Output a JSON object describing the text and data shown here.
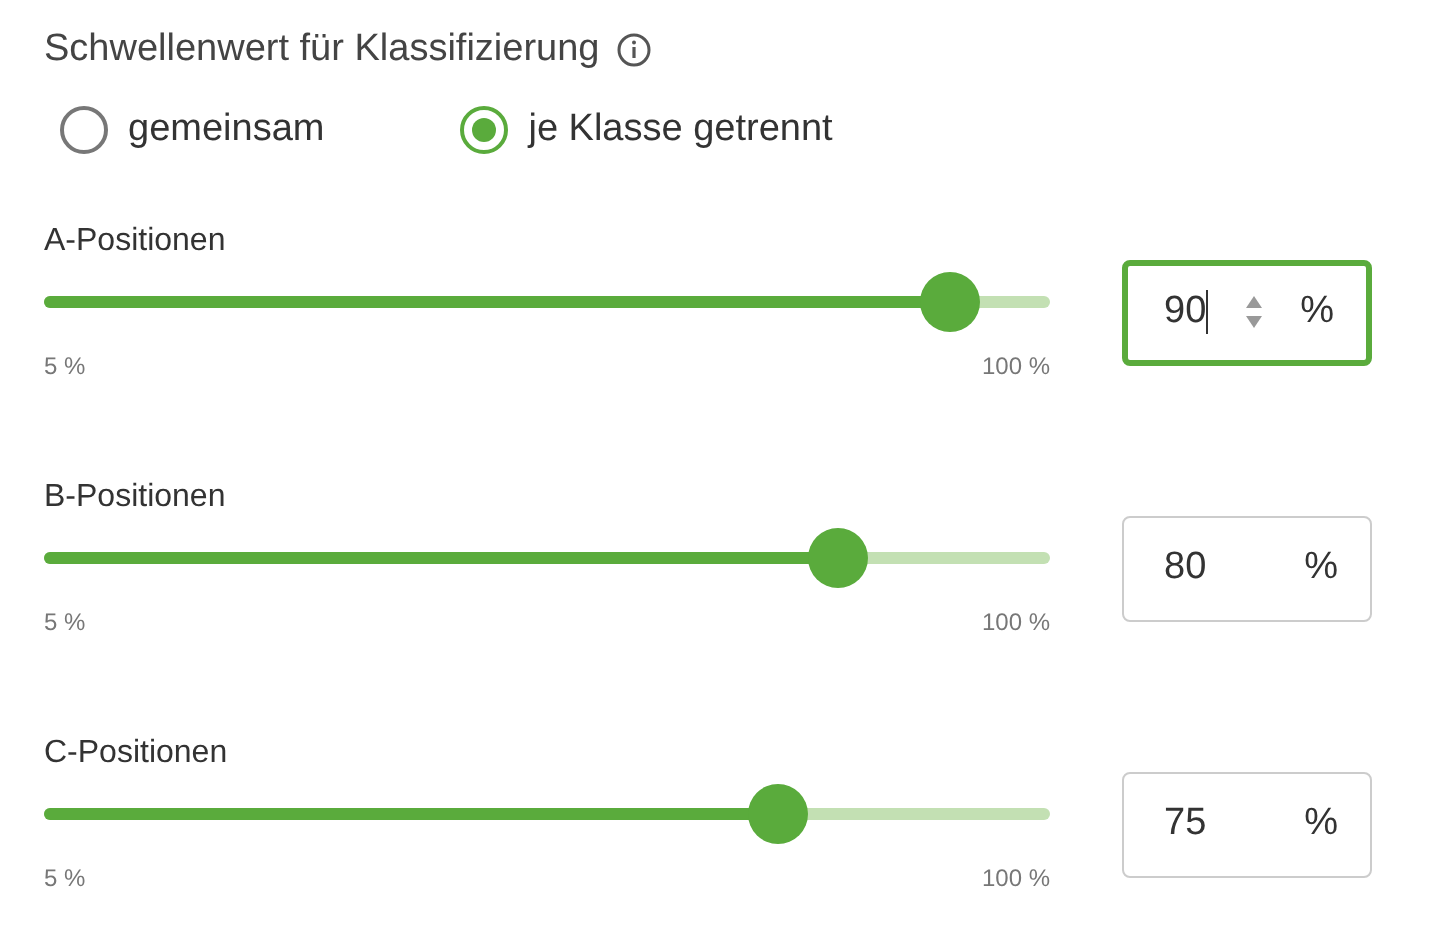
{
  "title": "Schwellenwert für Klassifizierung",
  "modes": [
    {
      "label": "gemeinsam",
      "selected": false
    },
    {
      "label": "je Klasse getrennt",
      "selected": true
    }
  ],
  "sliders": [
    {
      "label": "A-Positionen",
      "level": 0.9,
      "min_label": "5 %",
      "max_label": "100 %",
      "value": "90",
      "unit": "%",
      "focused": true
    },
    {
      "label": "B-Positionen",
      "level": 0.79,
      "min_label": "5 %",
      "max_label": "100 %",
      "value": "80",
      "unit": "%",
      "focused": false
    },
    {
      "label": "C-Positionen",
      "level": 0.73,
      "min_label": "5 %",
      "max_label": "100 %",
      "value": "75",
      "unit": "%",
      "focused": false
    }
  ]
}
